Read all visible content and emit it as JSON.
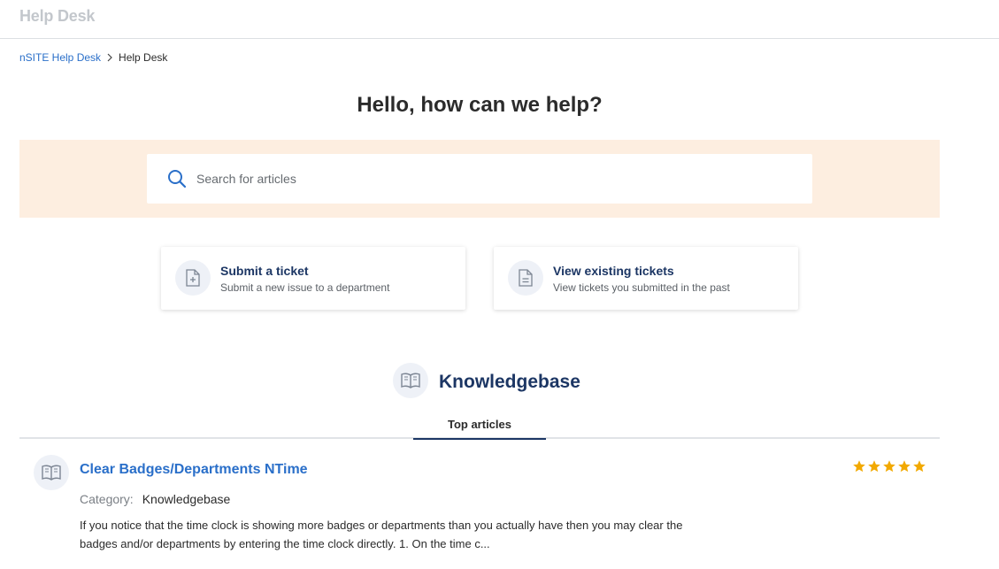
{
  "header": {
    "title": "Help Desk"
  },
  "breadcrumb": {
    "root": "nSITE Help Desk",
    "current": "Help Desk"
  },
  "hero": {
    "title": "Hello, how can we help?"
  },
  "search": {
    "placeholder": "Search for articles",
    "value": ""
  },
  "actions": [
    {
      "title": "Submit a ticket",
      "subtitle": "Submit a new issue to a department",
      "icon": "file-plus-icon"
    },
    {
      "title": "View existing tickets",
      "subtitle": "View tickets you submitted in the past",
      "icon": "file-text-icon"
    }
  ],
  "knowledgebase": {
    "title": "Knowledgebase",
    "icon": "open-book-icon",
    "tab": "Top articles"
  },
  "articles": [
    {
      "title": "Clear Badges/Departments NTime",
      "category_label": "Category:",
      "category": "Knowledgebase",
      "excerpt": "If you notice that the time clock is showing more badges or departments than you actually have then you may clear the badges and/or departments by entering the time clock directly.   1.  On the time c...",
      "rating": 5,
      "rating_max": 5
    }
  ],
  "colors": {
    "accent": "#1c3664",
    "link": "#2a6fc9",
    "band": "#fdeee0",
    "star": "#f2a900"
  }
}
